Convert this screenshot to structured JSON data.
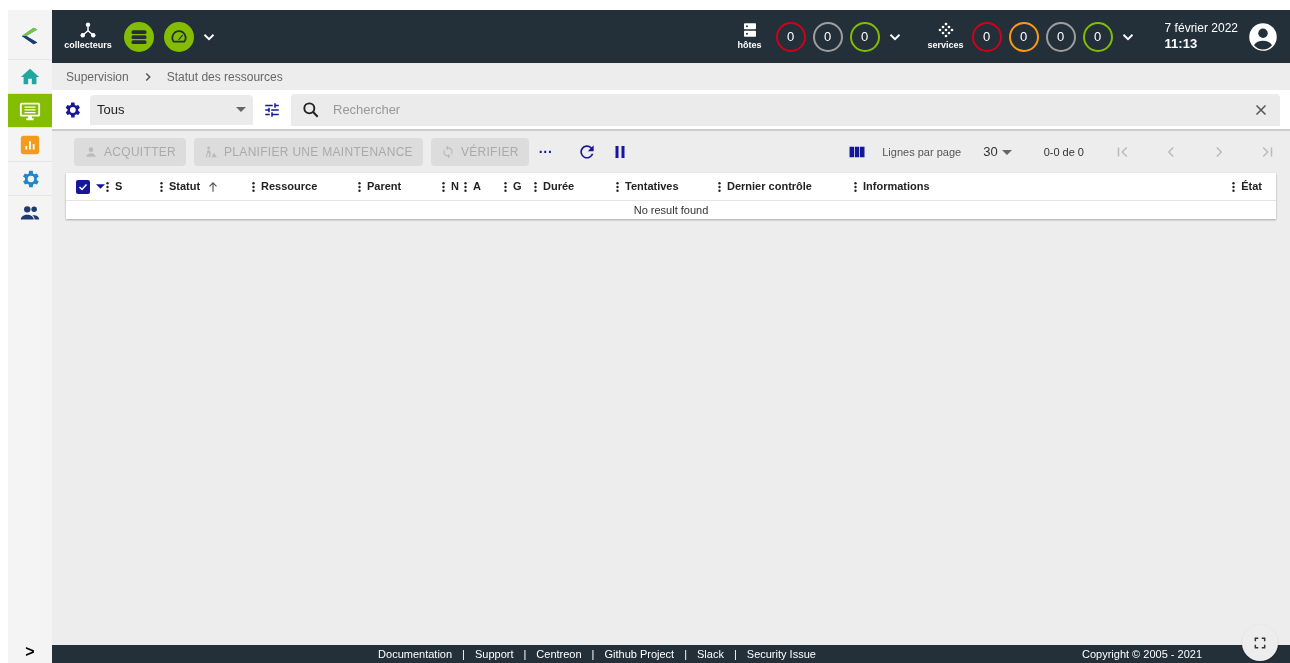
{
  "sidebar": {
    "items": [
      {
        "selected": false
      },
      {
        "selected": true
      },
      {
        "selected": false
      },
      {
        "selected": false
      },
      {
        "selected": false
      }
    ],
    "expand": ">"
  },
  "topbar": {
    "pollers_label": "collecteurs",
    "hosts_label": "hôtes",
    "hosts": [
      {
        "value": "0",
        "color": "#d0021b"
      },
      {
        "value": "0",
        "color": "#9e9e9e"
      },
      {
        "value": "0",
        "color": "#84bd00"
      }
    ],
    "services_label": "services",
    "services": [
      {
        "value": "0",
        "color": "#d0021b"
      },
      {
        "value": "0",
        "color": "#ff9913"
      },
      {
        "value": "0",
        "color": "#9e9e9e"
      },
      {
        "value": "0",
        "color": "#84bd00"
      }
    ],
    "date": "7 février 2022",
    "time": "11:13"
  },
  "breadcrumb": [
    "Supervision",
    "Statut des ressources"
  ],
  "filter": {
    "value": "Tous",
    "search_placeholder": "Rechercher"
  },
  "actions": [
    {
      "label": "ACQUITTER",
      "disabled": true
    },
    {
      "label": "PLANIFIER UNE MAINTENANCE",
      "disabled": true
    },
    {
      "label": "VÉRIFIER",
      "disabled": true
    }
  ],
  "more": "···",
  "pagination": {
    "rows_label": "Lignes par page",
    "rows_value": "30",
    "range": "0-0 de 0"
  },
  "table": {
    "select_all_checked": true,
    "columns": [
      {
        "label": "S",
        "sorted": false
      },
      {
        "label": "Statut",
        "sorted": true
      },
      {
        "label": "Ressource",
        "sorted": false
      },
      {
        "label": "Parent",
        "sorted": false
      },
      {
        "label": "N",
        "sorted": false
      },
      {
        "label": "A",
        "sorted": false
      },
      {
        "label": "G",
        "sorted": false
      },
      {
        "label": "Durée",
        "sorted": false
      },
      {
        "label": "Tentatives",
        "sorted": false
      },
      {
        "label": "Dernier contrôle",
        "sorted": false
      },
      {
        "label": "Informations",
        "sorted": false
      },
      {
        "label": "État",
        "sorted": false
      }
    ],
    "empty_message": "No result found"
  },
  "footer": {
    "links": [
      "Documentation",
      "Support",
      "Centreon",
      "Github Project",
      "Slack",
      "Security Issue"
    ],
    "separator": "|",
    "copyright": "Copyright © 2005 - 2021"
  }
}
